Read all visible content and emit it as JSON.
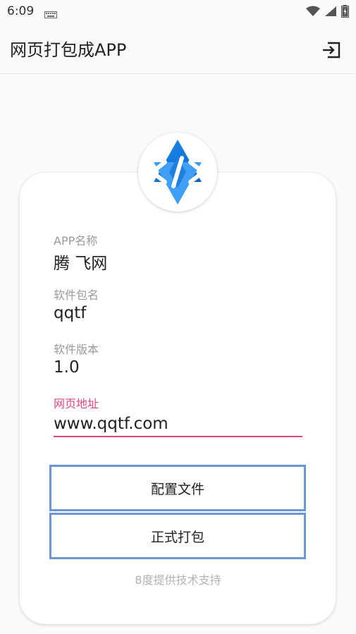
{
  "status_bar": {
    "time": "6:09",
    "icons": [
      "keyboard-icon",
      "wifi-icon",
      "signal-icon",
      "battery-icon"
    ]
  },
  "app_bar": {
    "title": "网页打包成APP",
    "action_icon": "login-icon"
  },
  "logo": {
    "icon": "code-brackets-icon",
    "accent": "#1f7fe0"
  },
  "form": {
    "app_name_label": "APP名称",
    "app_name_value": "腾 飞网",
    "package_label": "软件包名",
    "package_value": "qqtf",
    "version_label": "软件版本",
    "version_value": "1.0",
    "url_label": "网页地址",
    "url_value": "www.qqtf.com"
  },
  "buttons": {
    "config": "配置文件",
    "build": "正式打包"
  },
  "footer": "8度提供技术支持",
  "colors": {
    "accent_pink": "#e0457d",
    "button_border": "#6d96d8",
    "background": "#fafafa"
  }
}
